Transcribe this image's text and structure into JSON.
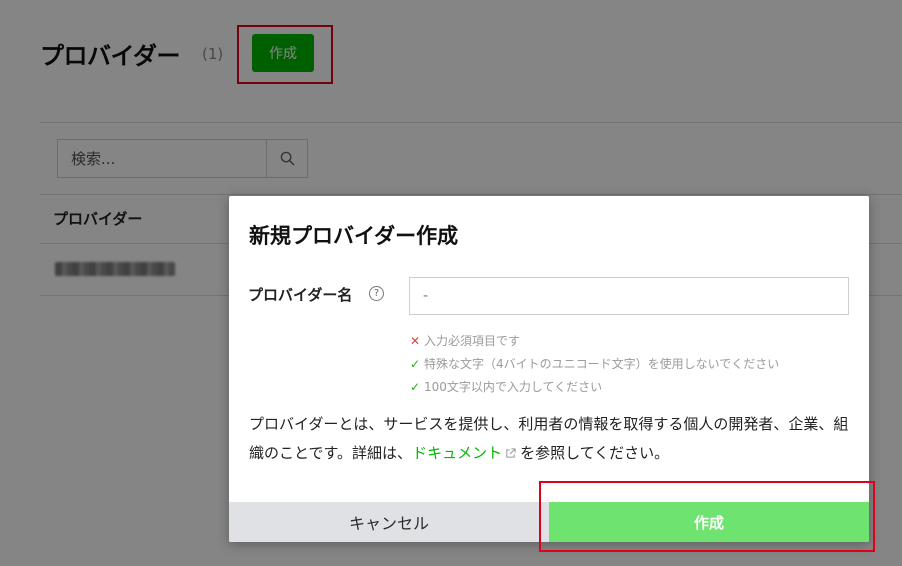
{
  "page": {
    "title": "プロバイダー",
    "count": "(1)",
    "create_label": "作成",
    "search_placeholder": "検索...",
    "column_header": "プロバイダー"
  },
  "modal": {
    "title": "新規プロバイダー作成",
    "field_label": "プロバイダー名",
    "help_symbol": "?",
    "input_value": "-",
    "rules": [
      {
        "status": "invalid",
        "mark": "✕",
        "text": "入力必須項目です"
      },
      {
        "status": "valid",
        "mark": "✓",
        "text": "特殊な文字（4バイトのユニコード文字）を使用しないでください"
      },
      {
        "status": "valid",
        "mark": "✓",
        "text": "100文字以内で入力してください"
      }
    ],
    "description_before": "プロバイダーとは、サービスを提供し、利用者の情報を取得する個人の開発者、企業、組織のことです。詳細は、",
    "doc_link": "ドキュメント",
    "description_after": "を参照してください。",
    "cancel_label": "キャンセル",
    "create_label": "作成"
  },
  "colors": {
    "brand_green": "#00b900",
    "create_disabled": "#6fe36f",
    "highlight_red": "#e0001b",
    "error_red": "#e2403a",
    "ok_green": "#1bb31b"
  },
  "icons": {
    "search": "search-icon",
    "help": "help-circle-icon",
    "external_link": "external-link-icon",
    "cross": "cross-icon",
    "check": "check-icon"
  }
}
